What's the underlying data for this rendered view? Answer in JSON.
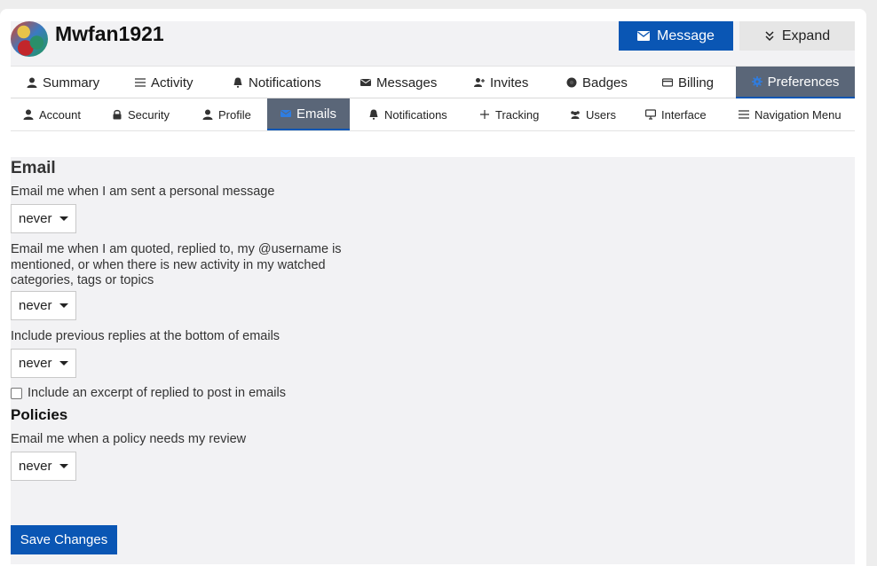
{
  "profile": {
    "username": "Mwfan1921",
    "message_label": "Message",
    "expand_label": "Expand"
  },
  "nav_primary": [
    {
      "label": "Summary",
      "icon": "user-icon"
    },
    {
      "label": "Activity",
      "icon": "list-icon"
    },
    {
      "label": "Notifications",
      "icon": "bell-icon"
    },
    {
      "label": "Messages",
      "icon": "envelope-icon"
    },
    {
      "label": "Invites",
      "icon": "user-plus-icon"
    },
    {
      "label": "Badges",
      "icon": "badge-icon"
    },
    {
      "label": "Billing",
      "icon": "credit-card-icon"
    },
    {
      "label": "Preferences",
      "icon": "gear-icon",
      "active": true
    }
  ],
  "nav_secondary": [
    {
      "label": "Account",
      "icon": "user-icon"
    },
    {
      "label": "Security",
      "icon": "lock-icon"
    },
    {
      "label": "Profile",
      "icon": "user-icon"
    },
    {
      "label": "Emails",
      "icon": "envelope-icon",
      "active": true
    },
    {
      "label": "Notifications",
      "icon": "bell-icon"
    },
    {
      "label": "Tracking",
      "icon": "plus-icon"
    },
    {
      "label": "Users",
      "icon": "users-icon"
    },
    {
      "label": "Interface",
      "icon": "desktop-icon"
    },
    {
      "label": "Navigation Menu",
      "icon": "menu-icon"
    }
  ],
  "email": {
    "title": "Email",
    "pm_label": "Email me when I am sent a personal message",
    "pm_value": "never",
    "mention_label": "Email me when I am quoted, replied to, my @username is mentioned, or when there is new activity in my watched categories, tags or topics",
    "mention_value": "never",
    "previous_label": "Include previous replies at the bottom of emails",
    "previous_value": "never",
    "excerpt_label": "Include an excerpt of replied to post in emails"
  },
  "policies": {
    "title": "Policies",
    "review_label": "Email me when a policy needs my review",
    "review_value": "never"
  },
  "save_label": "Save Changes",
  "colors": {
    "primary": "#0a56b4",
    "active_tab": "#5a6678",
    "content_bg": "#f2f2f4"
  }
}
